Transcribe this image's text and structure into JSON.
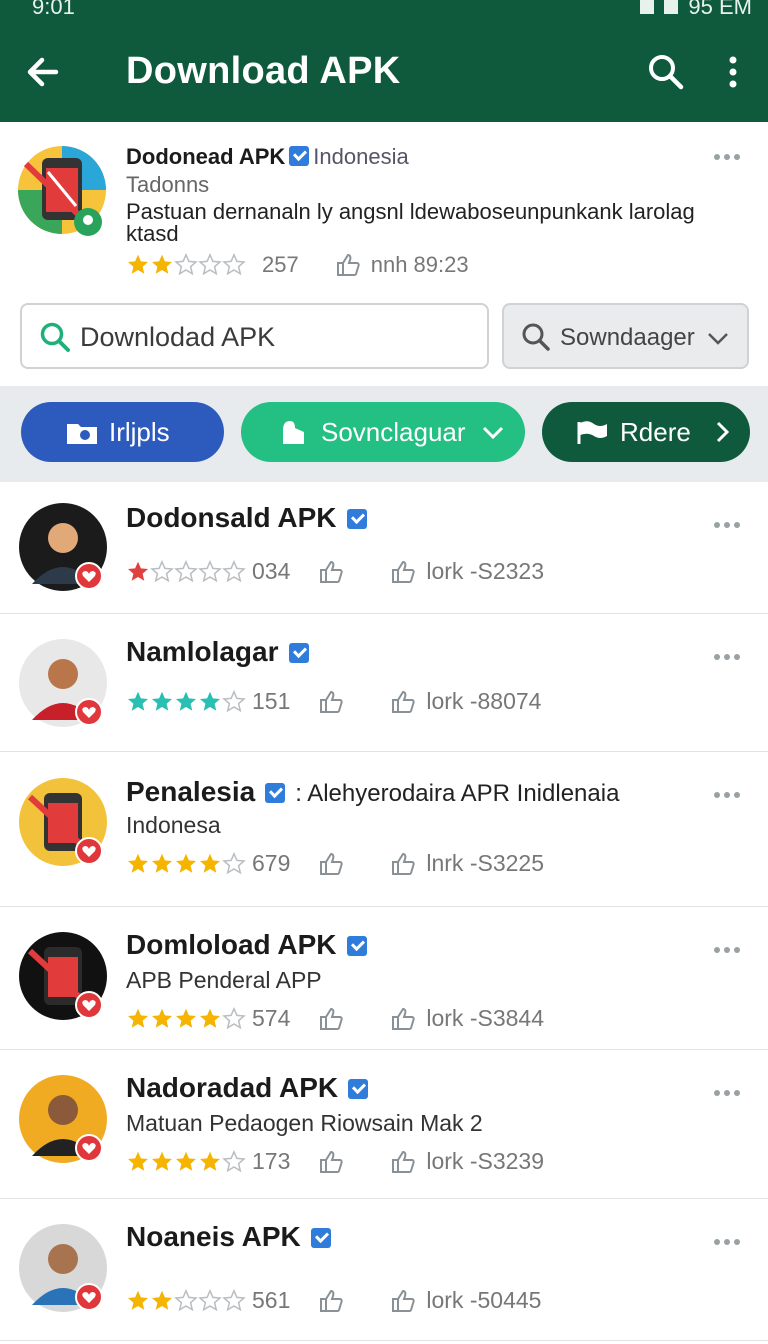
{
  "status": {
    "time": "9:01",
    "clock_right": "95 EM"
  },
  "appbar": {
    "title": "Download APK"
  },
  "hero": {
    "name": "Dodonead APK",
    "region": "Indonesia",
    "subtitle": "Tadonns",
    "description": "Pastuan dernanaln ly angsnl ldewaboseunpunkank larolag ktasd",
    "rating_count": "257",
    "meta_text": "nnh 89:23",
    "rating": 2
  },
  "search": {
    "value": "Downlodad APK",
    "filter_label": "Sowndaager"
  },
  "chips": [
    {
      "label": "Irljpls"
    },
    {
      "label": "Sovnclaguar"
    },
    {
      "label": "Rdere"
    }
  ],
  "colors": {
    "appbar": "#0f5a3c",
    "chip_blue": "#2d5bbd",
    "chip_green": "#23bf83",
    "chip_dark": "#0f5a3c",
    "star_gold": "#f5b400",
    "star_red": "#e0413f",
    "star_teal": "#2bbfb3"
  },
  "items": [
    {
      "name": "Dodonsald APK",
      "inline": "",
      "sub": "",
      "rating": 1,
      "star_color": "red",
      "count": "034",
      "code": "lork -S2323",
      "avatar": "person-avatar"
    },
    {
      "name": "Namlolagar",
      "inline": "",
      "sub": "",
      "rating": 4,
      "star_color": "teal",
      "count": "151",
      "code": "lork -88074",
      "avatar": "person-avatar"
    },
    {
      "name": "Penalesia",
      "inline": ": Alehyerodaira APR Inidlenaia",
      "sub": "Indonesa",
      "rating": 4,
      "star_color": "gold",
      "count": "679",
      "code": "lnrk -S3225",
      "avatar": "app-avatar"
    },
    {
      "name": "Domloload APK",
      "inline": "",
      "sub": "APB Penderal APP",
      "rating": 4,
      "star_color": "gold",
      "count": "574",
      "code": "lork -S3844",
      "avatar": "app-avatar"
    },
    {
      "name": "Nadoradad APK",
      "inline": "",
      "sub": "Matuan Pedaogen Riowsain Mak 2",
      "rating": 4,
      "star_color": "gold",
      "count": "173",
      "code": "lork -S3239",
      "avatar": "person-avatar"
    },
    {
      "name": "Noaneis APK",
      "inline": "",
      "sub": "",
      "rating": 2,
      "star_color": "gold",
      "count": "561",
      "code": "lork -50445",
      "avatar": "person-avatar"
    }
  ]
}
